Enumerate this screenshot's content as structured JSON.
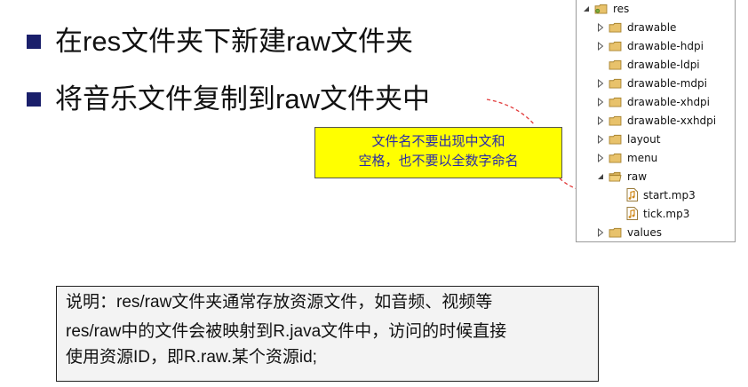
{
  "slide": {
    "bullets": [
      "在res文件夹下新建raw文件夹",
      "将音乐文件复制到raw文件夹中"
    ],
    "bullet_color": "#1a1f6b"
  },
  "callout": {
    "line1": "文件名不要出现中文和",
    "line2": "空格，也不要以全数字命名",
    "background": "#ffff00",
    "text_color": "#2a2aa8",
    "arrow_color": "#e23a3a"
  },
  "tree": {
    "root": "res",
    "items": [
      {
        "label": "drawable",
        "state": "collapsed"
      },
      {
        "label": "drawable-hdpi",
        "state": "collapsed"
      },
      {
        "label": "drawable-ldpi",
        "state": "leaf"
      },
      {
        "label": "drawable-mdpi",
        "state": "collapsed"
      },
      {
        "label": "drawable-xhdpi",
        "state": "collapsed"
      },
      {
        "label": "drawable-xxhdpi",
        "state": "collapsed"
      },
      {
        "label": "layout",
        "state": "collapsed"
      },
      {
        "label": "menu",
        "state": "collapsed"
      },
      {
        "label": "raw",
        "state": "expanded"
      },
      {
        "label": "values",
        "state": "collapsed"
      }
    ],
    "raw_files": [
      "start.mp3",
      "tick.mp3"
    ],
    "folder_color": "#e8c26b",
    "file_icon_color": "#d08a1a"
  },
  "note": {
    "line1": "说明：res/raw文件夹通常存放资源文件，如音频、视频等",
    "line2": "res/raw中的文件会被映射到R.java文件中，访问的时候直接",
    "line3": "使用资源ID，即R.raw.某个资源id;"
  }
}
